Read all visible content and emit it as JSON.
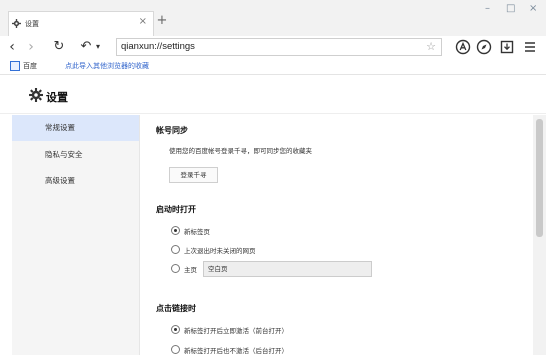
{
  "tab": {
    "title": "设置",
    "close_glyph": "×",
    "icon": "gear-icon"
  },
  "newtab_glyph": "+",
  "window_controls": {
    "minimize": "–",
    "maximize": "□",
    "close": "×"
  },
  "nav": {
    "back": "‹",
    "forward": "›",
    "reload": "↻",
    "undo": "↶",
    "undo_menu": "▾"
  },
  "address": {
    "url": "qianxun://settings",
    "star": "☆"
  },
  "toolbar_icons": [
    "a-circle-icon",
    "compass-icon",
    "download-box-icon",
    "menu-icon"
  ],
  "bookmarks": {
    "icon": "baidu-bookmark-icon",
    "item_label": "百度",
    "import_link": "点此导入其他浏览器的收藏"
  },
  "page": {
    "title": "设置",
    "icon": "gear-icon"
  },
  "sidebar": {
    "items": [
      {
        "label": "常规设置",
        "active": true
      },
      {
        "label": "隐私与安全",
        "active": false
      },
      {
        "label": "高级设置",
        "active": false
      }
    ]
  },
  "sync": {
    "title": "帐号同步",
    "description": "使用您的百度帐号登录千寻，即可同步您的收藏夹",
    "login_button": "登录千寻"
  },
  "startup": {
    "title": "启动时打开",
    "options": [
      {
        "label": "新标签页",
        "selected": true
      },
      {
        "label": "上次退出时未关闭的网页",
        "selected": false
      },
      {
        "label": "主页",
        "selected": false
      }
    ],
    "home_value": "空白页"
  },
  "links": {
    "title": "点击链接时",
    "options": [
      {
        "label": "新标签打开后立即激活（前台打开）",
        "selected": true
      },
      {
        "label": "新标签打开后也不激活（后台打开）",
        "selected": false
      }
    ]
  },
  "colors": {
    "accent": "#3370d6",
    "sidebar_active": "#dce7fb",
    "tabbar_bg": "#f2f2f2"
  }
}
